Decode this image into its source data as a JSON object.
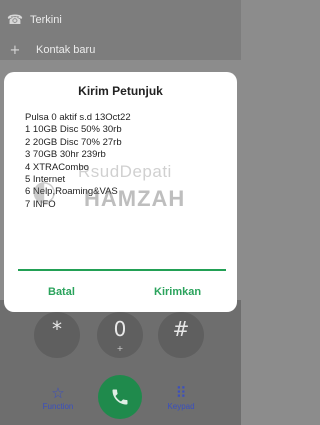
{
  "background": {
    "recent_label": "Terkini",
    "recent_icon": "phone-icon",
    "new_contact_label": "Kontak baru",
    "new_contact_icon": "plus-icon",
    "keys": [
      {
        "main": "*",
        "sub": ""
      },
      {
        "main": "0",
        "sub": "+"
      },
      {
        "main": "#",
        "sub": ""
      }
    ],
    "function_label": "Function",
    "keypad_label": "Keypad"
  },
  "dialog": {
    "title": "Kirim Petunjuk",
    "lines": [
      "Pulsa 0 aktif s.d 13Oct22",
      "1 10GB Disc 50% 30rb",
      "2 20GB Disc 70% 27rb",
      "3 70GB 30hr 239rb",
      "4 XTRACombo",
      "5 Internet",
      "6 Nelp,Roaming&VAS",
      "7 INFO"
    ],
    "cancel_label": "Batal",
    "send_label": "Kirimkan"
  },
  "watermark": {
    "top": "RsudDepati",
    "bottom": "HAMZAH"
  },
  "colors": {
    "accent": "#2aa35c",
    "call": "#1f8a4c",
    "dialog_bg": "#ffffff"
  }
}
